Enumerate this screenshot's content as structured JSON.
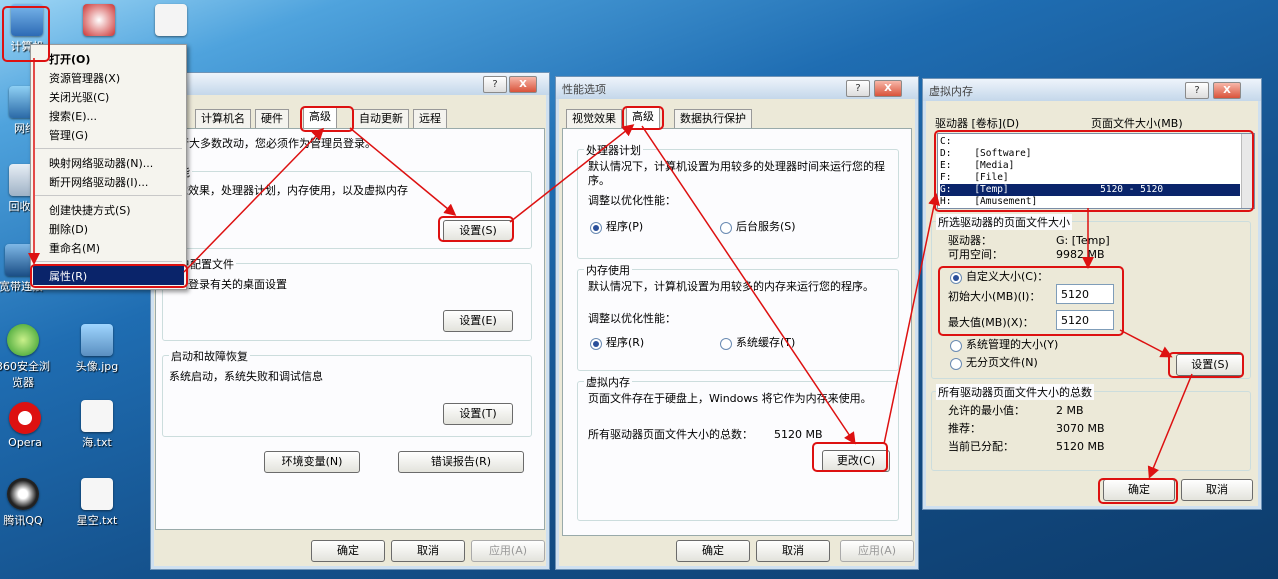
{
  "desktop": {
    "icons": [
      {
        "label": "计算机"
      },
      {
        "label": "网络"
      },
      {
        "label": "回收站"
      },
      {
        "label": "宽带连接"
      },
      {
        "label": "360安全浏览器"
      },
      {
        "label": "头像.jpg"
      },
      {
        "label": "Opera"
      },
      {
        "label": "海.txt"
      },
      {
        "label": "腾讯QQ"
      },
      {
        "label": "星空.txt"
      }
    ]
  },
  "context_menu": {
    "items": [
      "打开(O)",
      "资源管理器(X)",
      "关闭光驱(C)",
      "搜索(E)...",
      "管理(G)",
      "映射网络驱动器(N)...",
      "断开网络驱动器(I)...",
      "创建快捷方式(S)",
      "删除(D)",
      "重命名(M)",
      "属性(R)"
    ]
  },
  "sysprops": {
    "tabs": [
      "计算机名",
      "硬件",
      "高级",
      "自动更新",
      "远程"
    ],
    "note": "行大多数改动，您必须作为管理员登录。",
    "perf_group": "能",
    "perf_desc": "觉效果，处理器计划，内存使用，以及虚拟内存",
    "perf_btn": "设置(S)",
    "profile_group": "户配置文件",
    "profile_desc": "您登录有关的桌面设置",
    "profile_btn": "设置(E)",
    "startup_group": "启动和故障恢复",
    "startup_desc": "系统启动，系统失败和调试信息",
    "startup_btn": "设置(T)",
    "env_btn": "环境变量(N)",
    "err_btn": "错误报告(R)",
    "ok": "确定",
    "cancel": "取消",
    "apply": "应用(A)",
    "help_glyph": "?",
    "close_glyph": "X"
  },
  "perfopts": {
    "title": "性能选项",
    "tabs": [
      "视觉效果",
      "高级",
      "数据执行保护"
    ],
    "cpu_group": "处理器计划",
    "cpu_desc": "默认情况下，计算机设置为用较多的处理器时间来运行您的程序。",
    "adjust": "调整以优化性能：",
    "r_prog": "程序(P)",
    "r_bg": "后台服务(S)",
    "mem_group": "内存使用",
    "mem_desc": "默认情况下，计算机设置为用较多的内存来运行您的程序。",
    "adjust2": "调整以优化性能：",
    "r_prog2": "程序(R)",
    "r_cache": "系统缓存(T)",
    "vm_group": "虚拟内存",
    "vm_desc": "页面文件存在于硬盘上，Windows 将它作为内存来使用。",
    "vm_total_label": "所有驱动器页面文件大小的总数：",
    "vm_total": "5120 MB",
    "change_btn": "更改(C)",
    "ok": "确定",
    "cancel": "取消",
    "apply": "应用(A)",
    "help_glyph": "?",
    "close_glyph": "X"
  },
  "virtmem": {
    "title": "虚拟内存",
    "col_drive": "驱动器 [卷标](D)",
    "col_size": "页面文件大小(MB)",
    "drives": [
      {
        "text": "C:"
      },
      {
        "text": "D:    [Software]"
      },
      {
        "text": "E:    [Media]"
      },
      {
        "text": "F:    [File]"
      },
      {
        "text": "G:    [Temp]                5120 - 5120"
      },
      {
        "text": "H:    [Amusement]"
      }
    ],
    "sel_group": "所选驱动器的页面文件大小",
    "drive_label": "驱动器：",
    "drive_value": "G:  [Temp]",
    "free_label": "可用空间：",
    "free_value": "9982 MB",
    "r_custom": "自定义大小(C)：",
    "init_label": "初始大小(MB)(I)：",
    "init_value": "5120",
    "max_label": "最大值(MB)(X)：",
    "max_value": "5120",
    "r_sys": "系统管理的大小(Y)",
    "r_none": "无分页文件(N)",
    "set_btn": "设置(S)",
    "total_group": "所有驱动器页面文件大小的总数",
    "min_label": "允许的最小值：",
    "min_value": "2 MB",
    "rec_label": "推荐：",
    "rec_value": "3070 MB",
    "cur_label": "当前已分配：",
    "cur_value": "5120 MB",
    "ok": "确定",
    "cancel": "取消",
    "help_glyph": "?",
    "close_glyph": "X"
  },
  "colors": {
    "highlight": "#dd1111",
    "selection": "#0a246a"
  }
}
